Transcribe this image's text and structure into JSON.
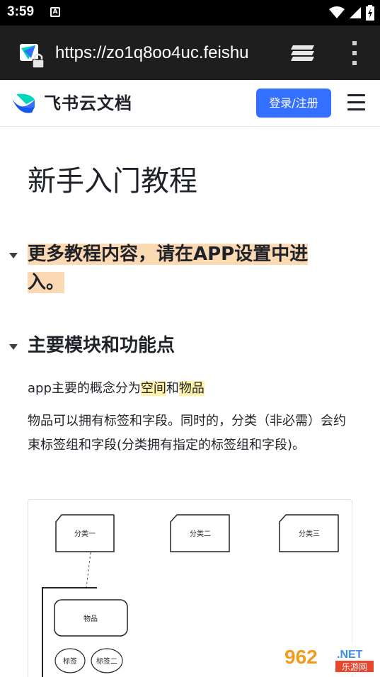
{
  "status_bar": {
    "time": "3:59",
    "notification_icon": "A"
  },
  "browser": {
    "url": "https://zo1q8oo4uc.feishu"
  },
  "site_header": {
    "logo_text": "飞书云文档",
    "login_label": "登录/注册"
  },
  "document": {
    "title": "新手入门教程",
    "callout_heading": "更多教程内容，请在APP设置中进入。",
    "section_heading": "主要模块和功能点",
    "para1_prefix": "app主要的概念分为",
    "para1_space": "空间",
    "para1_and": "和",
    "para1_item": "物品",
    "para2": "物品可以拥有标签和字段。同时的，分类（非必需）会约束标签组和字段(分类拥有指定的标签组和字段)。"
  },
  "diagram": {
    "category_one": "分类一",
    "category_two": "分类二",
    "category_three": "分类三",
    "item": "物品",
    "tag_one": "标签",
    "tag_two": "标签二"
  },
  "watermark": {
    "number": "962",
    "suffix": ".NET",
    "caption": "乐游网"
  },
  "colors": {
    "accent": "#3370ff",
    "highlight_orange": "#fbd9b3",
    "highlight_yellow": "#fff2a8"
  }
}
